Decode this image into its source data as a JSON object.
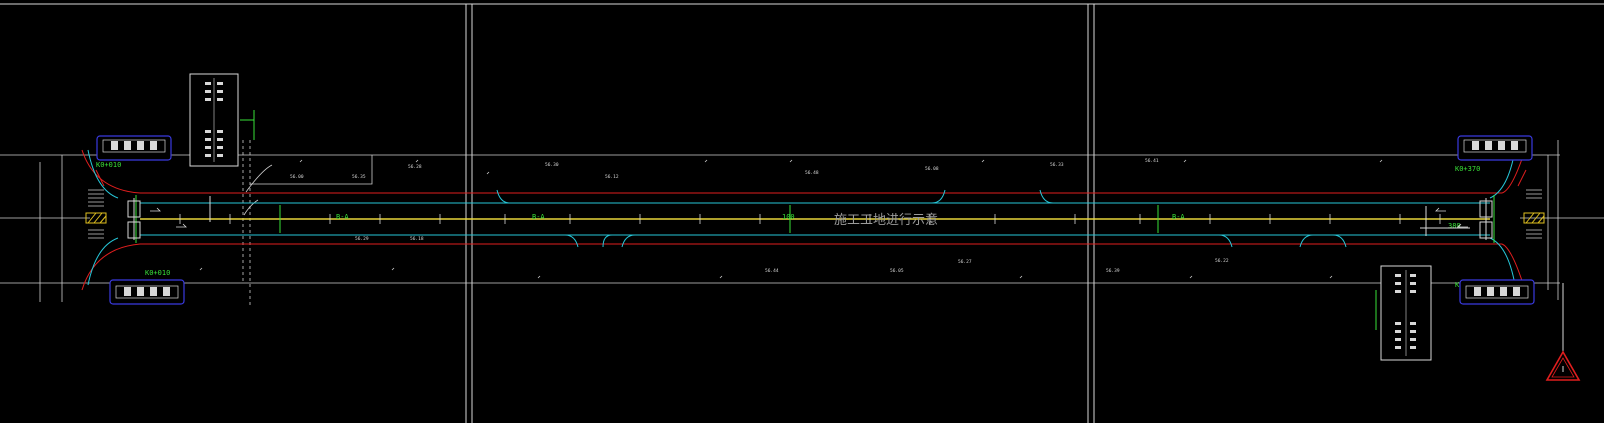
{
  "drawing": {
    "center_note": "施工工地进行示意",
    "colors": {
      "background": "#000000",
      "frame": "#d8d8d8",
      "kerb_red": "#e01e1e",
      "lane_cyan": "#26c6d8",
      "centerline_yellow": "#e8d63a",
      "annotation_green": "#38e038",
      "sign_blue": "#3a3ae0",
      "warning_red": "#e01e1e",
      "hatch_yellow": "#e0c020"
    },
    "labels": {
      "ch_a": "K0+010",
      "ch_b": "K0+370",
      "green_mark": "B-A",
      "mid_green": "100",
      "right_mark": "380"
    },
    "spot_levels": [
      "56.00",
      "56.35",
      "56.28",
      "56.30",
      "56.12",
      "56.48",
      "56.08",
      "56.33",
      "56.41",
      "56.29",
      "56.18",
      "56.44",
      "56.05",
      "56.27",
      "56.39",
      "56.22"
    ]
  }
}
